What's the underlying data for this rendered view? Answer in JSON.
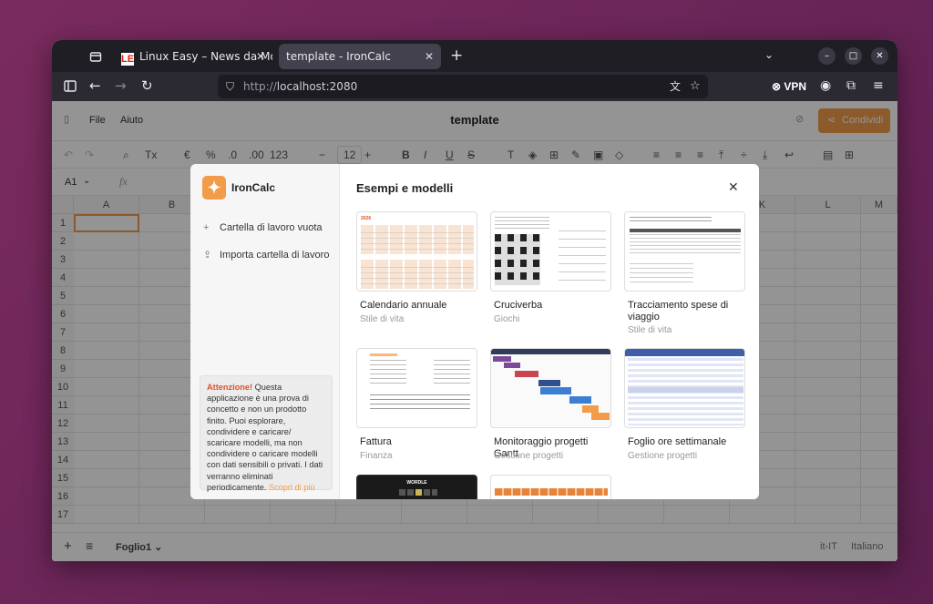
{
  "browser": {
    "tabs": [
      {
        "label": "Linux Easy – News da Mon",
        "icon": "linuxeasy-logo",
        "logo_text": "LE"
      },
      {
        "label": "template - IronCalc",
        "active": true
      }
    ],
    "close_glyph": "✕",
    "new_tab_glyph": "+",
    "url_prefix": "http://",
    "url_host": "localhost:2080",
    "vpn_label": "VPN"
  },
  "app": {
    "menu": {
      "file": "File",
      "help": "Aiuto"
    },
    "doc_title": "template",
    "share_label": "Condividi",
    "toolbar": {
      "number_format": "123",
      "font_size": "12",
      "currency": "€",
      "percent": "%"
    },
    "cell_ref": "A1",
    "fx": "fx",
    "columns": [
      "A",
      "B",
      "K",
      "L",
      "M"
    ],
    "rows": [
      "1",
      "2",
      "3",
      "4",
      "5",
      "6",
      "7",
      "8",
      "9",
      "10",
      "11",
      "12",
      "13",
      "14",
      "15",
      "16",
      "17"
    ],
    "sheet_tab": "Foglio1",
    "locale": "it-IT",
    "language": "Italiano"
  },
  "modal": {
    "brand": "IronCalc",
    "heading": "Esempi e modelli",
    "close": "✕",
    "side_items": [
      {
        "label": "Cartella di lavoro vuota",
        "icon": "plus-icon"
      },
      {
        "label": "Importa cartella di lavoro",
        "icon": "upload-icon"
      }
    ],
    "warning": {
      "title": "Attenzione!",
      "body": "Questa applicazione è una prova di concetto e non un prodotto finito. Puoi esplorare, condividere e caricare/ scaricare modelli, ma non condividere o caricare modelli con dati sensibili o privati. I dati verranno eliminati periodicamente.",
      "link": "Scopri di più"
    },
    "templates": [
      {
        "title": "Calendario annuale",
        "category": "Stile di vita",
        "thumb_year": "2026"
      },
      {
        "title": "Cruciverba",
        "category": "Giochi"
      },
      {
        "title": "Tracciamento spese di viaggio",
        "category": "Stile di vita"
      },
      {
        "title": "Fattura",
        "category": "Finanza"
      },
      {
        "title": "Monitoraggio progetti Gantt",
        "category": "Gestione progetti"
      },
      {
        "title": "Foglio ore settimanale",
        "category": "Gestione progetti"
      },
      {
        "title": "",
        "category": "",
        "thumb_text": "WORDLE"
      },
      {
        "title": "",
        "category": ""
      }
    ]
  },
  "colors": {
    "accent": "#f29c4a",
    "tab_bar": "#1f1e25",
    "nav_bar": "#2b2a33",
    "warning_title": "#e0502a"
  }
}
